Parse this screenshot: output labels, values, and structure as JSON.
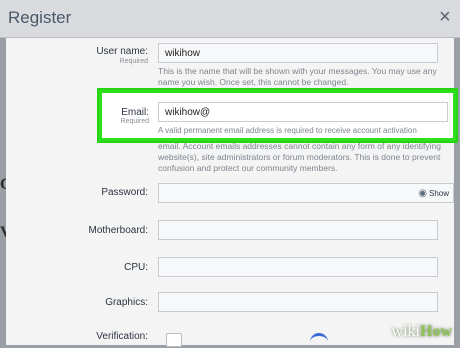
{
  "dialog": {
    "title": "Register",
    "close_icon": "close-icon"
  },
  "form": {
    "username": {
      "label": "User name:",
      "sublabel": "Required",
      "value": "wikihow",
      "help": "This is the name that will be shown with your messages. You may use any name you wish. Once set, this cannot be changed."
    },
    "email": {
      "label": "Email:",
      "sublabel": "Required",
      "value": "wikihow@",
      "help": "A valid permanent email address is required to receive account activation",
      "help_more": "email. Account emails addresses cannot contain any form of any identifying website(s), site administrators or forum moderators. This is done to prevent confusion and protect our community members."
    },
    "password": {
      "label": "Password:",
      "value": "",
      "show_label": "Show",
      "icon": "eye-icon"
    },
    "motherboard": {
      "label": "Motherboard:",
      "value": ""
    },
    "cpu": {
      "label": "CPU:",
      "value": ""
    },
    "graphics": {
      "label": "Graphics:",
      "value": ""
    },
    "verification": {
      "label": "Verification:"
    }
  },
  "watermark": {
    "wiki": "wiki",
    "how": "How"
  },
  "colors": {
    "highlight": "#2ce01a",
    "title": "#4b5968"
  }
}
